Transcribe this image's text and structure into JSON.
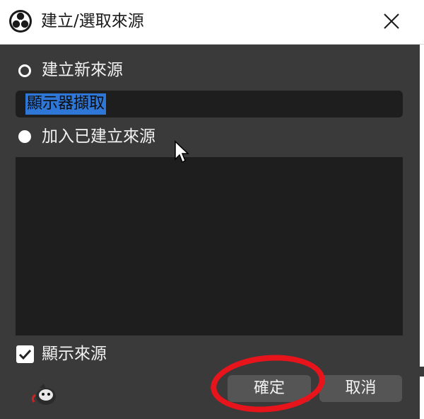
{
  "window": {
    "title": "建立/選取來源",
    "logo_icon": "obs-logo-icon",
    "close_icon": "close-icon"
  },
  "form": {
    "create_new": {
      "label": "建立新來源",
      "selected": false
    },
    "source_name": {
      "value": "顯示器擷取"
    },
    "add_existing": {
      "label": "加入已建立來源",
      "selected": true
    },
    "existing_sources": [],
    "visible": {
      "label": "顯示來源",
      "checked": true
    }
  },
  "buttons": {
    "ok_label": "確定",
    "cancel_label": "取消"
  },
  "colors": {
    "dialog_bg": "#3a3a3a",
    "input_bg": "#1e1e1e",
    "selection": "#2f77d6",
    "button_bg": "#555555",
    "annotation": "#e8141c"
  }
}
